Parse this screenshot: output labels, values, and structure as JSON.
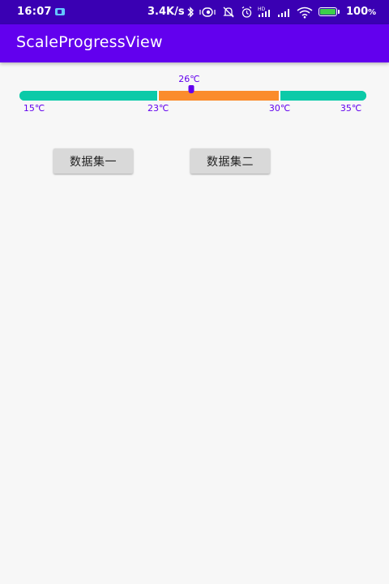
{
  "status_bar": {
    "time": "16:07",
    "app_icon": "camera-notification-icon",
    "network_speed": "3.4K/s",
    "icons": [
      "bluetooth-icon",
      "vibrate-icon",
      "mute-icon",
      "alarm-icon",
      "hd-signal-icon",
      "signal-icon",
      "wifi-icon"
    ],
    "battery_percent": "100",
    "battery_suffix": "%",
    "battery_color": "#3ccf4a"
  },
  "app_bar": {
    "title": "ScaleProgressView",
    "color": "#6200ee"
  },
  "scale_progress": {
    "min": 15,
    "max": 35,
    "current": 26,
    "current_label": "26℃",
    "ticks": [
      {
        "value": 15,
        "label": "15℃"
      },
      {
        "value": 23,
        "label": "23℃"
      },
      {
        "value": 30,
        "label": "30℃"
      },
      {
        "value": 35,
        "label": "35℃"
      }
    ],
    "segments": [
      {
        "from": 15,
        "to": 23,
        "color": "#0ccaa8"
      },
      {
        "from": 23,
        "to": 30,
        "color": "#fb8c2c"
      },
      {
        "from": 30,
        "to": 35,
        "color": "#0ccaa8"
      }
    ],
    "indicator_color": "#6200ee"
  },
  "buttons": {
    "dataset_one": "数据集一",
    "dataset_two": "数据集二"
  }
}
